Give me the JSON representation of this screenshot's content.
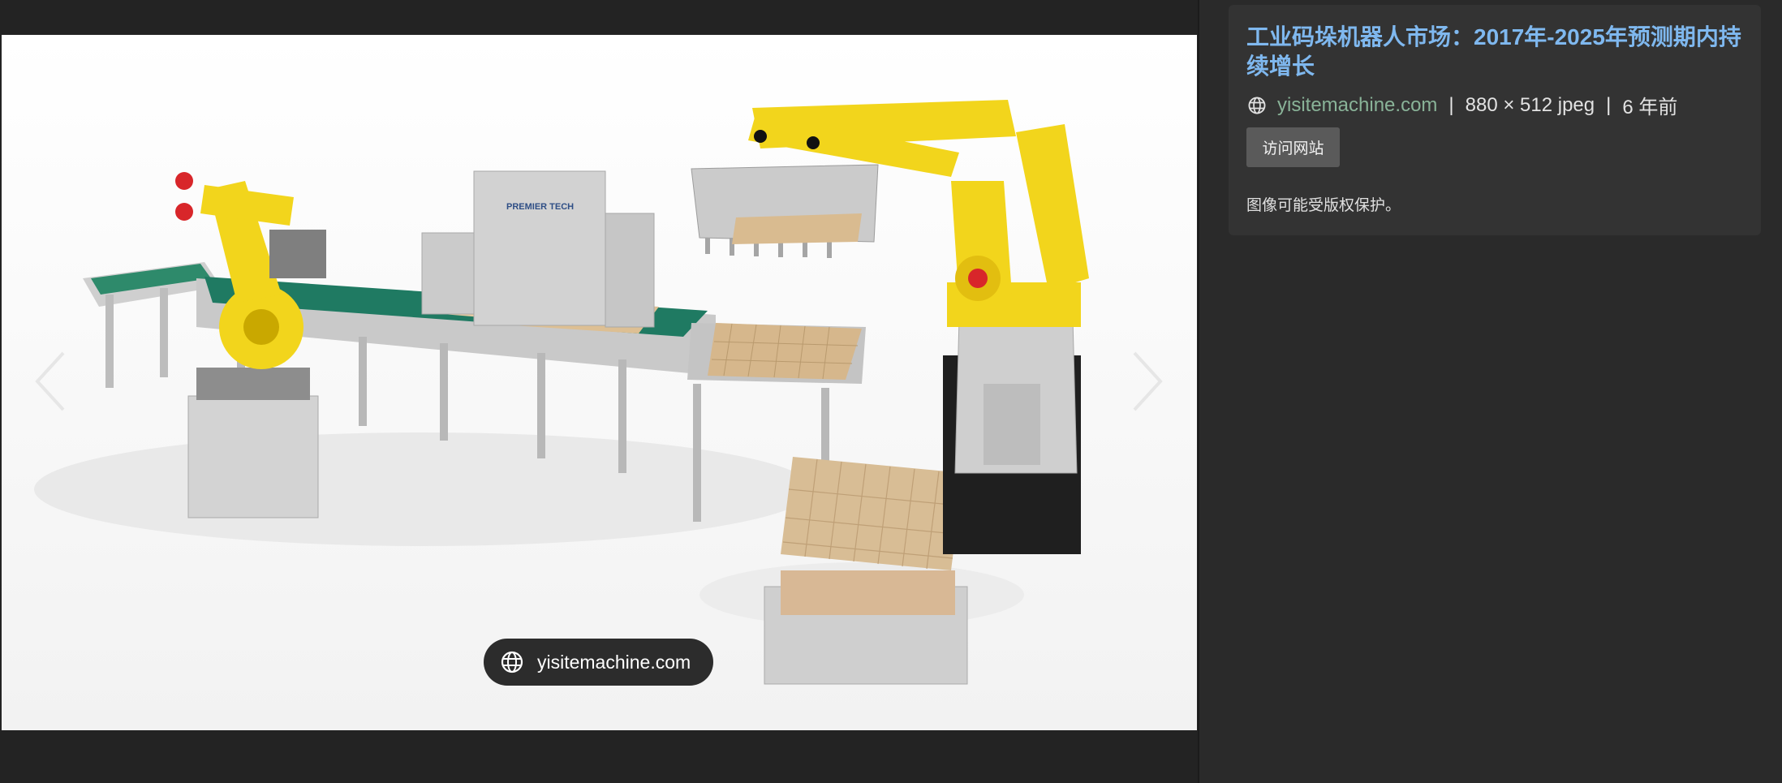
{
  "panel": {
    "title": "工业码垛机器人市场：2017年-2025年预测期内持续增长",
    "site": "yisitemachine.com",
    "separator": "|",
    "dimensions": "880 × 512 jpeg",
    "age": "6 年前",
    "visit_button": "访问网站",
    "copyright": "图像可能受版权保护。"
  },
  "viewer": {
    "source_label": "yisitemachine.com",
    "image_brand_text": "PREMIER TECH"
  },
  "icons": {
    "prev": "chevron-left-icon",
    "next": "chevron-right-icon",
    "globe": "globe-icon"
  },
  "colors": {
    "background": "#232323",
    "panel": "#2a2a2a",
    "card": "#333333",
    "title": "#7fb8ef",
    "site_link": "#89b398",
    "robot_yellow": "#f2d51c",
    "conveyor_green": "#1f7a62"
  }
}
